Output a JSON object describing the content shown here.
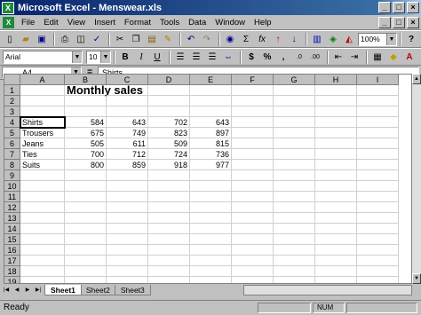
{
  "window": {
    "title": "Microsoft Excel - Menswear.xls",
    "min": "_",
    "max": "□",
    "close": "×"
  },
  "menu": [
    "File",
    "Edit",
    "View",
    "Insert",
    "Format",
    "Tools",
    "Data",
    "Window",
    "Help"
  ],
  "toolbar": {
    "font": "Arial",
    "size": "10",
    "zoom": "100%",
    "bold": "B",
    "italic": "I",
    "underline": "U",
    "currency": "$",
    "percent": "%",
    "sum": "Σ",
    "fx": "fx"
  },
  "formula_bar": {
    "name_box": "A4",
    "eq": "=",
    "content": "Shirts"
  },
  "columns": [
    "A",
    "B",
    "C",
    "D",
    "E",
    "F",
    "G",
    "H",
    "I"
  ],
  "rows": [
    "1",
    "2",
    "3",
    "4",
    "5",
    "6",
    "7",
    "8",
    "9",
    "10",
    "11",
    "12",
    "13",
    "14",
    "15",
    "16",
    "17",
    "18",
    "19"
  ],
  "sheet_title": "Monthly sales",
  "table": [
    {
      "item": "Shirts",
      "values": [
        "584",
        "643",
        "702",
        "643"
      ]
    },
    {
      "item": "Trousers",
      "values": [
        "675",
        "749",
        "823",
        "897"
      ]
    },
    {
      "item": "Jeans",
      "values": [
        "505",
        "611",
        "509",
        "815"
      ]
    },
    {
      "item": "Ties",
      "values": [
        "700",
        "712",
        "724",
        "736"
      ]
    },
    {
      "item": "Suits",
      "values": [
        "800",
        "859",
        "918",
        "977"
      ]
    }
  ],
  "sheets": [
    "Sheet1",
    "Sheet2",
    "Sheet3"
  ],
  "status": {
    "text": "Ready",
    "num": "NUM"
  }
}
